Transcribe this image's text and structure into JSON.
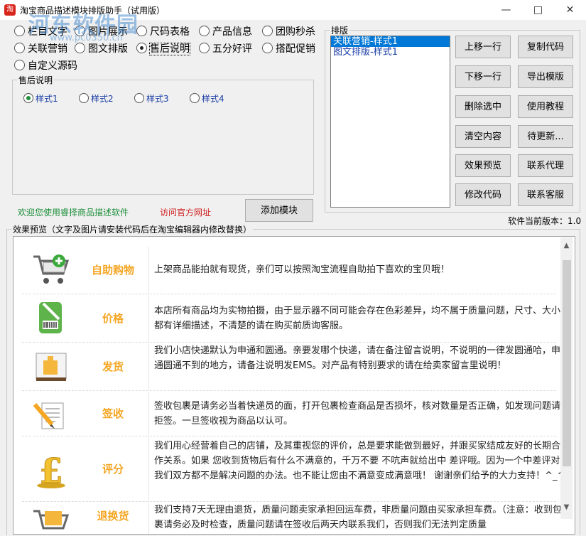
{
  "window": {
    "title": "淘宝商品描述模块排版助手（试用版）",
    "app_icon": "淘",
    "watermark": "河东软件园",
    "watermark_url": "www.pc0350.cn",
    "minimize": "—",
    "maximize": "□",
    "close": "✕"
  },
  "modules": [
    {
      "label": "栏目文字",
      "checked": false
    },
    {
      "label": "图片展示",
      "checked": false
    },
    {
      "label": "尺码表格",
      "checked": false
    },
    {
      "label": "产品信息",
      "checked": false
    },
    {
      "label": "团购秒杀",
      "checked": false
    },
    {
      "label": "关联营销",
      "checked": false
    },
    {
      "label": "图文排版",
      "checked": false
    },
    {
      "label": "售后说明",
      "checked": true
    },
    {
      "label": "五分好评",
      "checked": false
    },
    {
      "label": "搭配促销",
      "checked": false
    },
    {
      "label": "自定义源码",
      "checked": false
    }
  ],
  "aftersale": {
    "legend": "售后说明",
    "styles": [
      "样式1",
      "样式2",
      "样式3",
      "样式4"
    ],
    "selected": 0
  },
  "welcome_text": "欢迎您使用睿择商品描述软件",
  "official_link": "访问官方网址",
  "add_module_button": "添加模块",
  "layout": {
    "legend": "排版",
    "items": [
      "关联营销-样式1",
      "图文排版-样式1"
    ],
    "selected": 0
  },
  "buttons": {
    "move_up": "上移一行",
    "copy_code": "复制代码",
    "move_down": "下移一行",
    "export_template": "导出模版",
    "delete_selected": "删除选中",
    "tutorial": "使用教程",
    "clear_content": "清空内容",
    "pending_update": "待更新...",
    "preview": "效果预览",
    "contact_agent": "联系代理",
    "modify_code": "修改代码",
    "contact_support": "联系客服"
  },
  "version_text": "软件当前版本：1.0",
  "preview": {
    "legend": "效果预览（文字及图片请安装代码后在淘宝编辑器内修改替换）",
    "rows": [
      {
        "icon": "shopping-cart-icon",
        "name": "自助购物",
        "desc": "上架商品能拍就有现货，亲们可以按照淘宝流程自助拍下喜欢的宝贝哦！"
      },
      {
        "icon": "price-tag-icon",
        "name": "价格",
        "desc": "本店所有商品均为实物拍摄，由于显示器不同可能会存在色彩差异，均不属于质量问题，尺寸、大小都有详细描述，不清楚的请在购买前质询客服。"
      },
      {
        "icon": "delivery-box-icon",
        "name": "发货",
        "desc": "我们小店快递默认为申通和圆通。亲要发哪个快递，请在备注留言说明，不说明的一律发圆通哈，申通圆通不到的地方，请备注说明发EMS。对产品有特别要求的请在给卖家留言里说明！"
      },
      {
        "icon": "sign-pen-icon",
        "name": "签收",
        "desc": "签收包裹是请务必当着快递员的面，打开包裹检查商品是否损坏，核对数量是否正确，如发现问题请拒签。一旦签收视为商品以认可。"
      },
      {
        "icon": "pound-coin-icon",
        "name": "评分",
        "desc": "我们用心经营着自己的店铺，及其重视您的评价，总是要求能做到最好，并跟买家结成友好的长期合作关系。如果 您收到货物后有什么不满意的，千万不要 不吭声就给出中 差评哦。因为一个中差评对我们双方都不是解决问题的办法。也不能让您由不满意变成满意哦！ 谢谢亲们给予的大力支持！^_^"
      },
      {
        "icon": "return-cart-icon",
        "name": "退换货",
        "desc": "我们支持7天无理由退货，质量问题卖家承担回运车费，非质量问题由买家承担车费。（注意：收到包裹请务必及时检查，质量问题请在签收后两天内联系我们，否则我们无法判定质量"
      }
    ]
  }
}
